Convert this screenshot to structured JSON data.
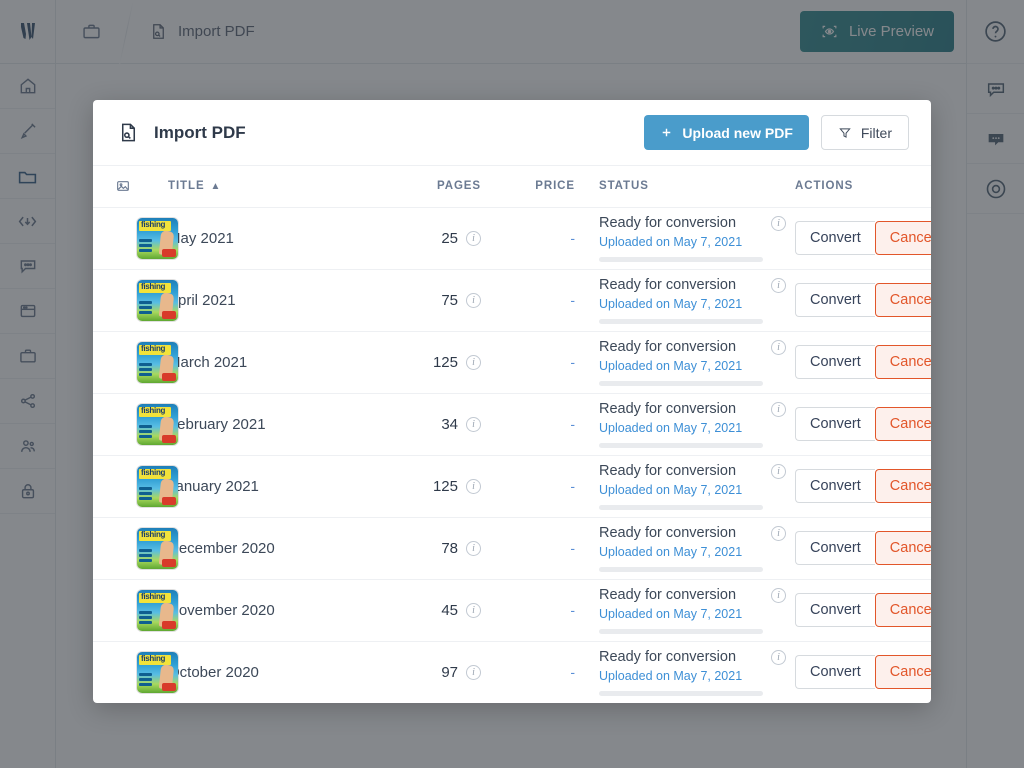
{
  "app": {
    "logo_name": "app-logo",
    "topbar": {
      "breadcrumb_icon": "briefcase-icon",
      "separator": "breadcrumb-separator",
      "page_icon": "pdf-file-icon",
      "page_title": "Import PDF",
      "live_preview_label": "Live Preview",
      "live_preview_icon": "eye-scan-icon",
      "live_preview_color": "#17787f"
    },
    "left_rail": [
      {
        "icon": "home-icon",
        "name": "sidebar-item-home",
        "active": false
      },
      {
        "icon": "brush-icon",
        "name": "sidebar-item-design",
        "active": false
      },
      {
        "icon": "folder-icon",
        "name": "sidebar-item-files",
        "active": true
      },
      {
        "icon": "code-download-icon",
        "name": "sidebar-item-export",
        "active": false
      },
      {
        "icon": "chat-icon",
        "name": "sidebar-item-messages",
        "active": false
      },
      {
        "icon": "window-icon",
        "name": "sidebar-item-pages",
        "active": false
      },
      {
        "icon": "briefcase-icon",
        "name": "sidebar-item-projects",
        "active": false
      },
      {
        "icon": "share-icon",
        "name": "sidebar-item-share",
        "active": false
      },
      {
        "icon": "users-icon",
        "name": "sidebar-item-team",
        "active": false
      },
      {
        "icon": "lock-icon",
        "name": "sidebar-item-security",
        "active": false
      }
    ],
    "right_rail": [
      {
        "icon": "help-circle-icon",
        "name": "help-button"
      },
      {
        "icon": "chat-outline-icon",
        "name": "chat-button"
      },
      {
        "icon": "chat-filled-icon",
        "name": "support-chat-button"
      },
      {
        "icon": "target-icon",
        "name": "onboarding-button"
      }
    ]
  },
  "modal": {
    "title": "Import PDF",
    "title_icon": "pdf-file-icon",
    "upload_label": "Upload new PDF",
    "upload_icon": "plus-icon",
    "upload_color": "#4a9ccb",
    "filter_label": "Filter",
    "filter_icon": "funnel-icon",
    "columns": {
      "thumb": "",
      "thumb_icon": "image-icon",
      "title": "TITLE",
      "title_sort": "ascending",
      "pages": "PAGES",
      "price": "PRICE",
      "status": "STATUS",
      "actions": "ACTIONS"
    },
    "row_actions": {
      "convert": "Convert",
      "cancel": "Cancel",
      "cancel_color": "#e2562a"
    },
    "info_icon": "info-icon",
    "rows": [
      {
        "thumb": "fishing-magazine-cover",
        "title": "May 2021",
        "pages": "25",
        "price": "-",
        "status": "Ready for conversion",
        "uploaded": "Uploaded on May 7, 2021"
      },
      {
        "thumb": "fishing-magazine-cover",
        "title": "April 2021",
        "pages": "75",
        "price": "-",
        "status": "Ready for conversion",
        "uploaded": "Uploaded on May 7, 2021"
      },
      {
        "thumb": "fishing-magazine-cover",
        "title": "March 2021",
        "pages": "125",
        "price": "-",
        "status": "Ready for conversion",
        "uploaded": "Uploaded on May 7, 2021"
      },
      {
        "thumb": "fishing-magazine-cover",
        "title": "February 2021",
        "pages": "34",
        "price": "-",
        "status": "Ready for conversion",
        "uploaded": "Uploaded on May 7, 2021"
      },
      {
        "thumb": "fishing-magazine-cover",
        "title": "January 2021",
        "pages": "125",
        "price": "-",
        "status": "Ready for conversion",
        "uploaded": "Uploaded on May 7, 2021"
      },
      {
        "thumb": "fishing-magazine-cover",
        "title": "December 2020",
        "pages": "78",
        "price": "-",
        "status": "Ready for conversion",
        "uploaded": "Uploaded on May 7, 2021"
      },
      {
        "thumb": "fishing-magazine-cover",
        "title": "November 2020",
        "pages": "45",
        "price": "-",
        "status": "Ready for conversion",
        "uploaded": "Uploaded on May 7, 2021"
      },
      {
        "thumb": "fishing-magazine-cover",
        "title": "October 2020",
        "pages": "97",
        "price": "-",
        "status": "Ready for conversion",
        "uploaded": "Uploaded on May 7, 2021"
      }
    ]
  }
}
